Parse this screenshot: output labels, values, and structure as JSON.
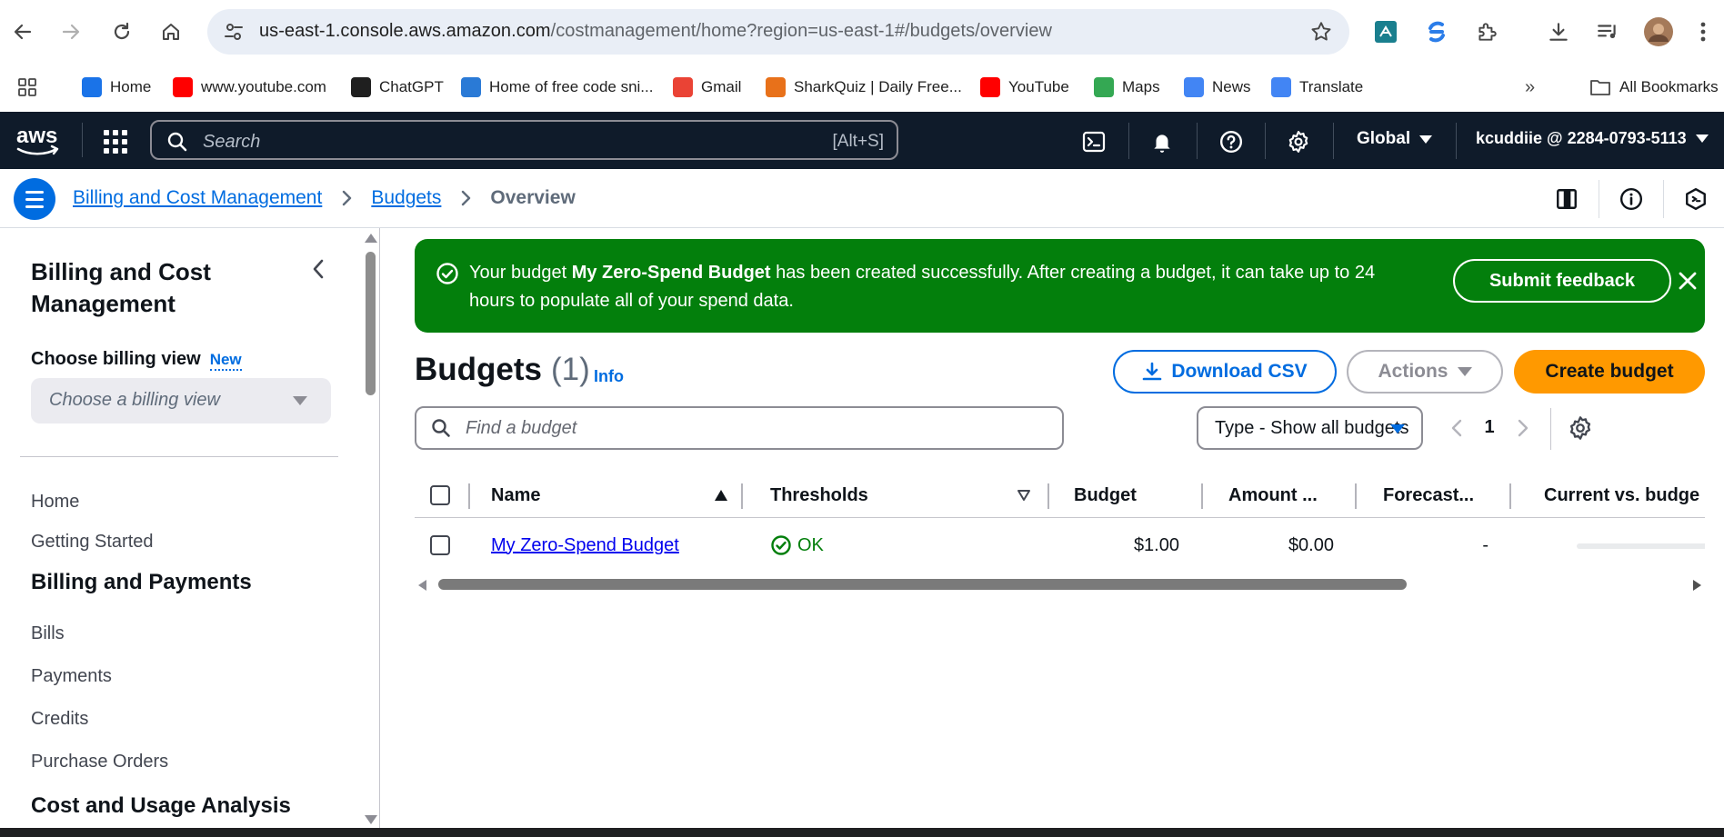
{
  "browser": {
    "url_host": "us-east-1.console.aws.amazon.com",
    "url_path": "/costmanagement/home?region=us-east-1#/budgets/overview",
    "bookmarks": [
      {
        "label": "Home",
        "icon": "home-bookmark-icon",
        "color": "#1a73e8"
      },
      {
        "label": "www.youtube.com",
        "icon": "youtube-icon",
        "color": "#ff0000"
      },
      {
        "label": "ChatGPT",
        "icon": "chatgpt-icon",
        "color": "#1f1f1f"
      },
      {
        "label": "Home of free code sni...",
        "icon": "code-snippet-icon",
        "color": "#2a7ad6"
      },
      {
        "label": "Gmail",
        "icon": "gmail-icon",
        "color": "#ea4335"
      },
      {
        "label": "SharkQuiz | Daily Free...",
        "icon": "sharkquiz-icon",
        "color": "#e8711a"
      },
      {
        "label": "YouTube",
        "icon": "youtube-icon",
        "color": "#ff0000"
      },
      {
        "label": "Maps",
        "icon": "maps-icon",
        "color": "#34a853"
      },
      {
        "label": "News",
        "icon": "news-icon",
        "color": "#4285f4"
      },
      {
        "label": "Translate",
        "icon": "translate-icon",
        "color": "#4285f4"
      }
    ],
    "all_bookmarks_label": "All Bookmarks",
    "overflow_label": "»"
  },
  "aws_nav": {
    "logo_text": "aws",
    "search_placeholder": "Search",
    "search_shortcut": "[Alt+S]",
    "region": "Global",
    "account": "kcuddiie @ 2284-0793-5113"
  },
  "breadcrumb": {
    "items": [
      "Billing and Cost Management",
      "Budgets",
      "Overview"
    ]
  },
  "sidenav": {
    "title": "Billing and Cost Management",
    "billing_view_label": "Choose billing view",
    "billing_view_badge": "New",
    "billing_view_placeholder": "Choose a billing view",
    "links_top": [
      "Home",
      "Getting Started"
    ],
    "section_billing": "Billing and Payments",
    "links_billing": [
      "Bills",
      "Payments",
      "Credits",
      "Purchase Orders"
    ],
    "section_cost": "Cost and Usage Analysis"
  },
  "flash": {
    "prefix": "Your budget ",
    "budget_name": "My Zero-Spend Budget",
    "suffix": " has been created successfully. After creating a budget, it can take up to 24 hours to populate all of your spend data.",
    "feedback_label": "Submit feedback",
    "color": "#037f0c"
  },
  "budgets": {
    "title": "Budgets",
    "count": "(1)",
    "info_label": "Info",
    "download_label": "Download CSV",
    "actions_label": "Actions",
    "create_label": "Create budget",
    "find_placeholder": "Find a budget",
    "type_filter": "Type - Show all budgets",
    "page": "1",
    "columns": [
      "Name",
      "Thresholds",
      "Budget",
      "Amount ...",
      "Forecast...",
      "Current vs. budge"
    ],
    "rows": [
      {
        "name": "My Zero-Spend Budget",
        "thresholds": "OK",
        "budget": "$1.00",
        "amount": "$0.00",
        "forecast": "-",
        "current_vs_budget_fraction": 0
      }
    ],
    "accent_color": "#006ce0",
    "create_color": "#ff9900"
  }
}
